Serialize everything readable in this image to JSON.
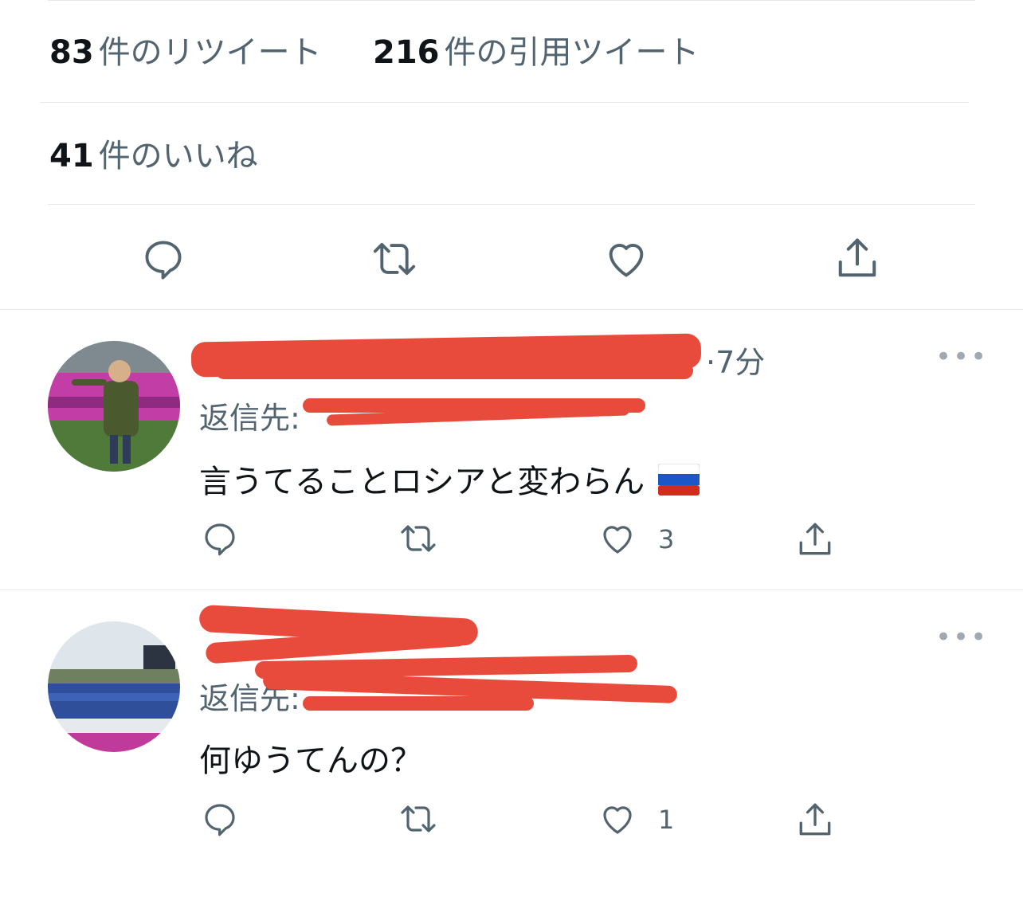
{
  "stats": {
    "retweets_count": "83",
    "retweets_label": "件のリツイート",
    "quotes_count": "216",
    "quotes_label": "件の引用ツイート",
    "likes_count": "41",
    "likes_label": "件のいいね"
  },
  "action_bar": {
    "icons": [
      "reply-icon",
      "retweet-icon",
      "like-icon",
      "share-icon"
    ]
  },
  "replies": [
    {
      "meta_suffix": "·7分",
      "reply_to_label": "返信先:",
      "text": "言うてることロシアと変わらん",
      "flag": "russia-flag",
      "like_count": "3",
      "more": "•••"
    },
    {
      "meta_suffix": "",
      "reply_to_label": "返信先:",
      "text": "何ゆうてんの？",
      "like_count": "1",
      "more": "•••"
    }
  ],
  "colors": {
    "text": "#0f1419",
    "secondary": "#536471",
    "link": "#1d9bf0",
    "redaction": "#e84b3c",
    "divider": "#e6e8eb"
  }
}
